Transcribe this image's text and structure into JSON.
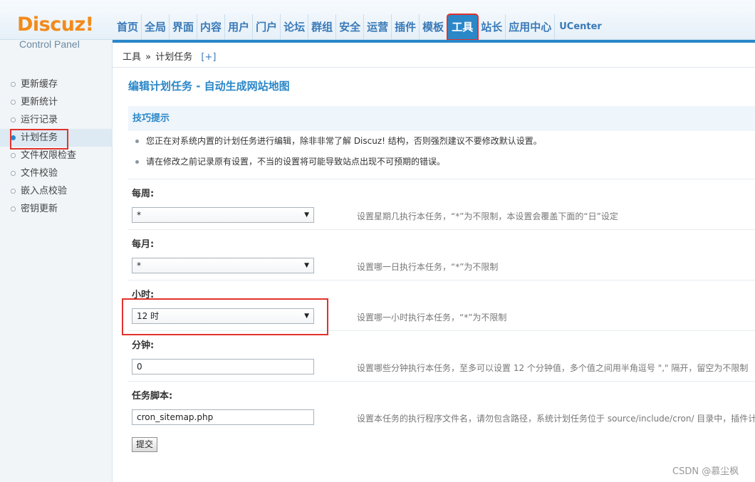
{
  "logo": {
    "main": "Discuz!",
    "sub": "Control Panel"
  },
  "nav": [
    "首页",
    "全局",
    "界面",
    "内容",
    "用户",
    "门户",
    "论坛",
    "群组",
    "安全",
    "运营",
    "插件",
    "模板",
    "工具",
    "站长",
    "应用中心",
    "UCenter"
  ],
  "nav_active": "工具",
  "breadcrumb": {
    "section": "工具",
    "sep": "»",
    "page": "计划任务",
    "add": "[+]"
  },
  "sidebar": [
    "更新缓存",
    "更新统计",
    "运行记录",
    "计划任务",
    "文件权限检查",
    "文件校验",
    "嵌入点校验",
    "密钥更新"
  ],
  "sidebar_active": "计划任务",
  "page_title": "编辑计划任务 - 自动生成网站地图",
  "tips": {
    "title": "技巧提示",
    "items": [
      "您正在对系统内置的计划任务进行编辑，除非非常了解 Discuz! 结构，否则强烈建议不要修改默认设置。",
      "请在修改之前记录原有设置，不当的设置将可能导致站点出现不可预期的错误。"
    ]
  },
  "fields": {
    "weekday": {
      "label": "每周:",
      "value": "*",
      "help": "设置星期几执行本任务，“*”为不限制，本设置会覆盖下面的“日”设定"
    },
    "day": {
      "label": "每月:",
      "value": "*",
      "help": "设置哪一日执行本任务，“*”为不限制"
    },
    "hour": {
      "label": "小时:",
      "value": "12 时",
      "help": "设置哪一小时执行本任务，“*”为不限制"
    },
    "minute": {
      "label": "分钟:",
      "value": "0",
      "help": "设置哪些分钟执行本任务，至多可以设置 12 个分钟值，多个值之间用半角逗号 \",\" 隔开，留空为不限制"
    },
    "script": {
      "label": "任务脚本:",
      "value": "cron_sitemap.php",
      "help": "设置本任务的执行程序文件名，请勿包含路径，系统计划任务位于 source/include/cron/ 目录中，插件计"
    }
  },
  "submit_label": "提交",
  "watermark": "CSDN @慕尘枫"
}
